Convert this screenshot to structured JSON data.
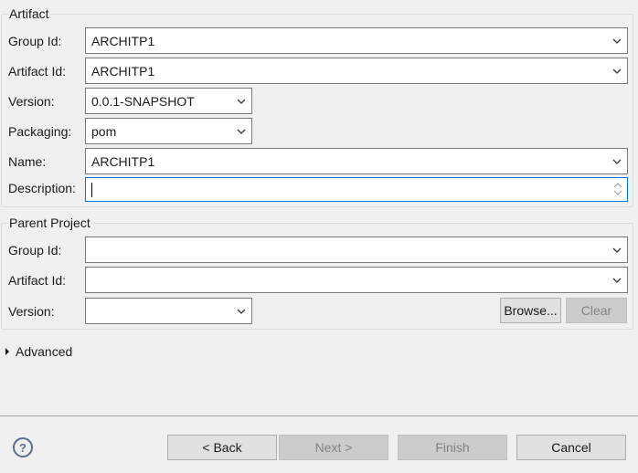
{
  "artifact": {
    "title": "Artifact",
    "group_id_label": "Group Id:",
    "group_id_value": "ARCHITP1",
    "artifact_id_label": "Artifact Id:",
    "artifact_id_value": "ARCHITP1",
    "version_label": "Version:",
    "version_value": "0.0.1-SNAPSHOT",
    "packaging_label": "Packaging:",
    "packaging_value": "pom",
    "name_label": "Name:",
    "name_value": "ARCHITP1",
    "description_label": "Description:",
    "description_value": ""
  },
  "parent": {
    "title": "Parent Project",
    "group_id_label": "Group Id:",
    "group_id_value": "",
    "artifact_id_label": "Artifact Id:",
    "artifact_id_value": "",
    "version_label": "Version:",
    "version_value": "",
    "browse_label": "Browse...",
    "clear_label": "Clear"
  },
  "advanced": {
    "label": "Advanced"
  },
  "footer": {
    "help_glyph": "?",
    "back_label": "< Back",
    "next_label": "Next >",
    "finish_label": "Finish",
    "cancel_label": "Cancel"
  },
  "icons": {
    "dropdown": "chevron-down-icon",
    "spinner": "spinner-icon",
    "help": "help-icon",
    "expand": "expand-triangle-icon"
  },
  "colors": {
    "focus_border": "#0078d7",
    "window_bg": "#f0f0f0",
    "disabled_text": "#838383"
  }
}
